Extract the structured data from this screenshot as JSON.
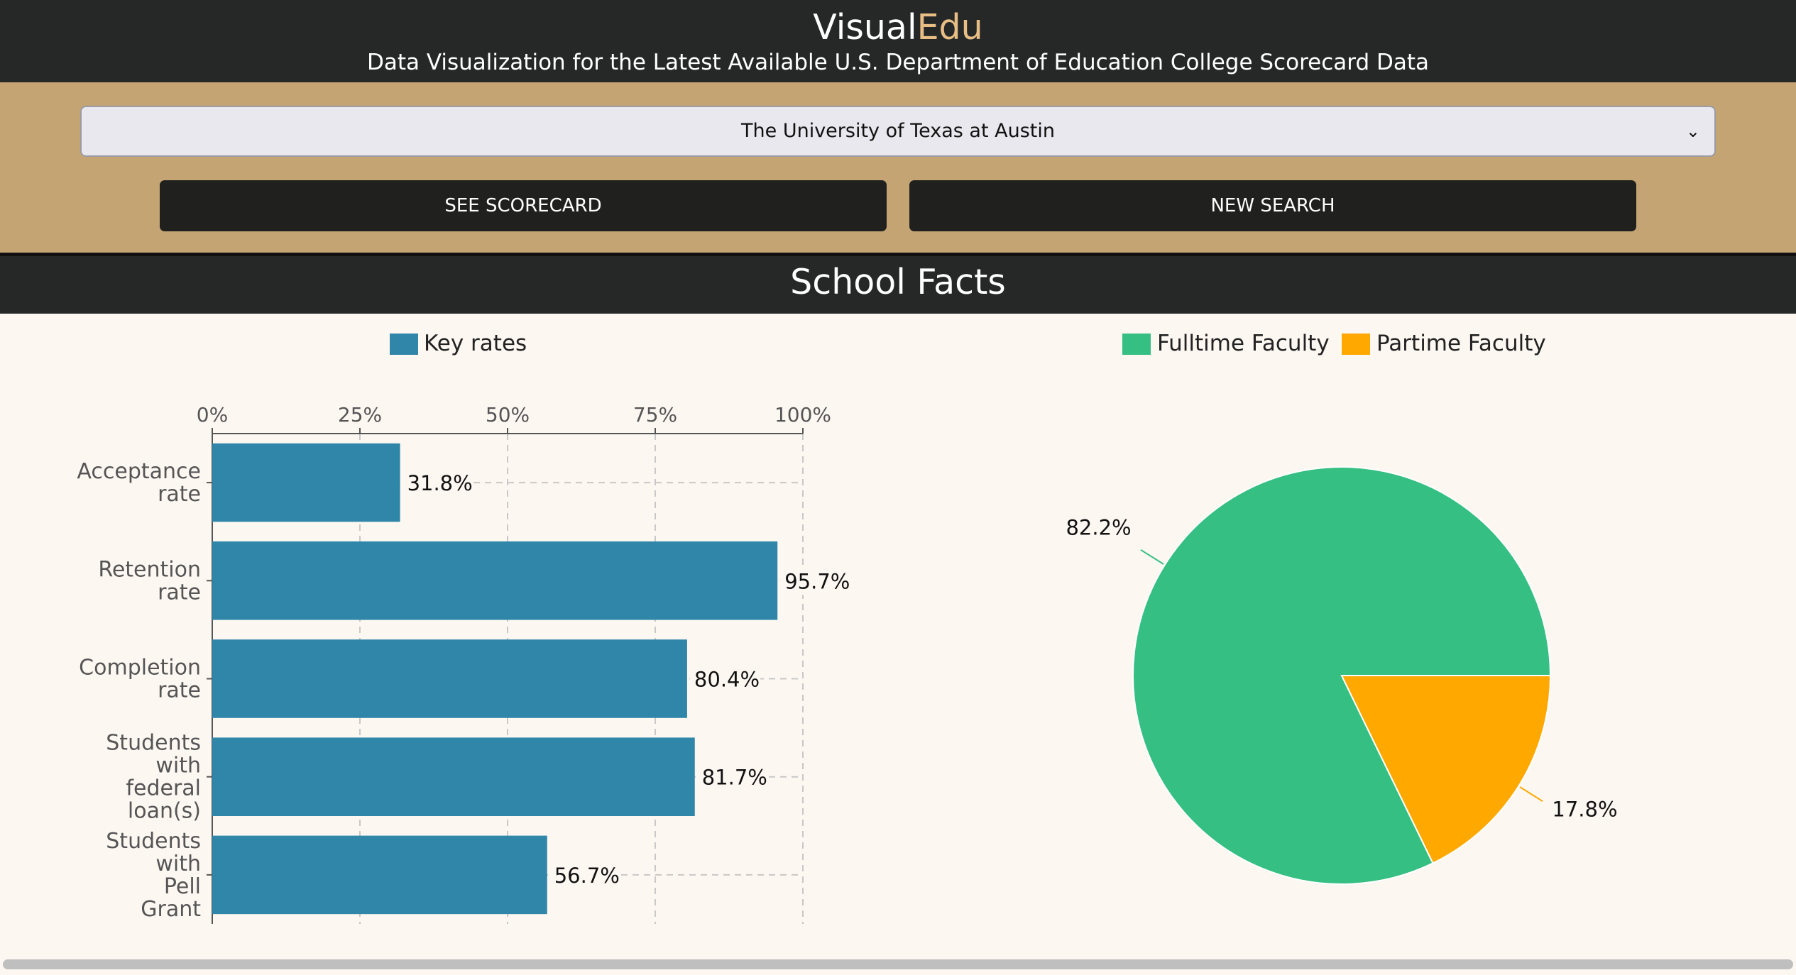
{
  "header": {
    "brand_part1": "Visual",
    "brand_part2": "Edu",
    "subtitle": "Data Visualization for the Latest Available U.S. Department of Education College Scorecard Data"
  },
  "search": {
    "selected_school": "The University of Texas at Austin",
    "see_scorecard_label": "SEE SCORECARD",
    "new_search_label": "NEW SEARCH"
  },
  "section": {
    "title": "School Facts"
  },
  "colors": {
    "bar": "#2f86a8",
    "fulltime": "#36bf82",
    "parttime": "#fea800",
    "brand_accent": "#e8be85",
    "header_bg": "#262828",
    "search_bg": "#c5a474"
  },
  "chart_data": [
    {
      "type": "bar",
      "orientation": "horizontal",
      "legend": [
        "Key rates"
      ],
      "categories": [
        [
          "Acceptance",
          "rate"
        ],
        [
          "Retention",
          "rate"
        ],
        [
          "Completion",
          "rate"
        ],
        [
          "Students",
          "with",
          "federal",
          "loan(s)"
        ],
        [
          "Students",
          "with",
          "Pell",
          "Grant"
        ]
      ],
      "series": [
        {
          "name": "Key rates",
          "values": [
            31.8,
            95.7,
            80.4,
            81.7,
            56.7
          ]
        }
      ],
      "value_labels": [
        "31.8%",
        "95.7%",
        "80.4%",
        "81.7%",
        "56.7%"
      ],
      "xlim": [
        0,
        100
      ],
      "xticks": [
        0,
        25,
        50,
        75,
        100
      ],
      "xtick_labels": [
        "0%",
        "25%",
        "50%",
        "75%",
        "100%"
      ],
      "x_axis_position": "top",
      "grid": true
    },
    {
      "type": "pie",
      "legend": [
        "Fulltime Faculty",
        "Partime Faculty"
      ],
      "labels": [
        "Fulltime Faculty",
        "Partime Faculty"
      ],
      "values": [
        82.2,
        17.8
      ],
      "value_labels": [
        "82.2%",
        "17.8%"
      ]
    }
  ]
}
